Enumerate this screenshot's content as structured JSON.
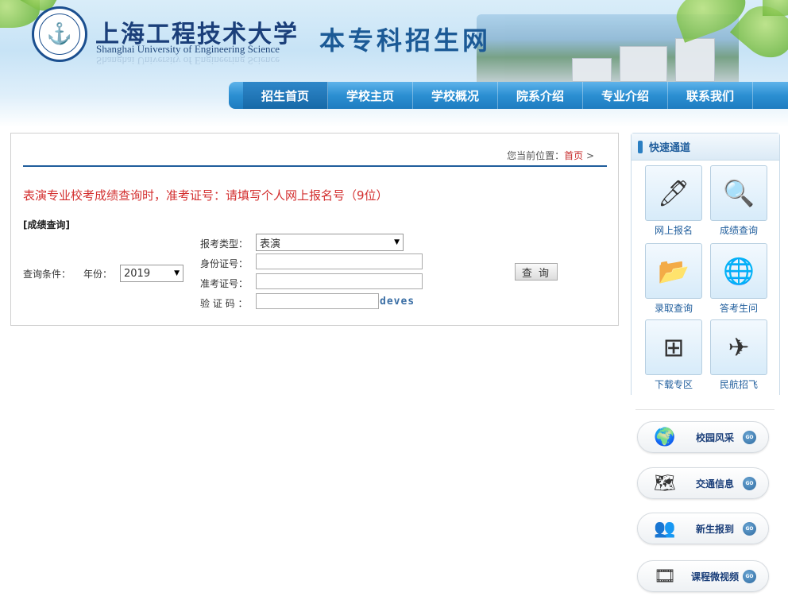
{
  "header": {
    "school_name_cn": "上海工程技术大学",
    "school_name_en": "Shanghai University of Engineering Science",
    "site_title": "本专科招生网"
  },
  "nav": {
    "items": [
      {
        "label": "招生首页",
        "active": true
      },
      {
        "label": "学校主页",
        "active": false
      },
      {
        "label": "学校概况",
        "active": false
      },
      {
        "label": "院系介绍",
        "active": false
      },
      {
        "label": "专业介绍",
        "active": false
      },
      {
        "label": "联系我们",
        "active": false
      }
    ]
  },
  "breadcrumb": {
    "prefix": "您当前位置：",
    "home": "首页",
    "separator": ">"
  },
  "main": {
    "notice": "表演专业校考成绩查询时，准考证号：请填写个人网上报名号（9位）",
    "section_label": "[成绩查询]",
    "condition_label": "查询条件：",
    "year_label": "年份：",
    "year_value": "2019",
    "type_label": "报考类型：",
    "type_value": "表演",
    "id_label": "身份证号：",
    "exam_no_label": "准考证号：",
    "captcha_label": "验 证 码 ：",
    "captcha_text": "deves",
    "query_button": "查 询"
  },
  "sidebar": {
    "title": "快速通道",
    "quick_links": [
      {
        "label": "网上报名",
        "icon": "online-signup-icon"
      },
      {
        "label": "成绩查询",
        "icon": "score-query-icon"
      },
      {
        "label": "录取查询",
        "icon": "admission-query-icon"
      },
      {
        "label": "答考生问",
        "icon": "faq-icon"
      },
      {
        "label": "下载专区",
        "icon": "download-icon"
      },
      {
        "label": "民航招飞",
        "icon": "aviation-icon"
      }
    ],
    "pills": [
      {
        "label": "校园风采",
        "icon": "globe-icon",
        "go": "GO"
      },
      {
        "label": "交通信息",
        "icon": "map-icon",
        "go": "GO"
      },
      {
        "label": "新生报到",
        "icon": "students-icon",
        "go": "GO"
      },
      {
        "label": "课程微视频",
        "icon": "film-reel-icon",
        "go": "GO"
      }
    ]
  },
  "colors": {
    "nav_blue": "#2b8fd2",
    "notice_red": "#d32f2f",
    "link_blue": "#1f5d9c"
  }
}
